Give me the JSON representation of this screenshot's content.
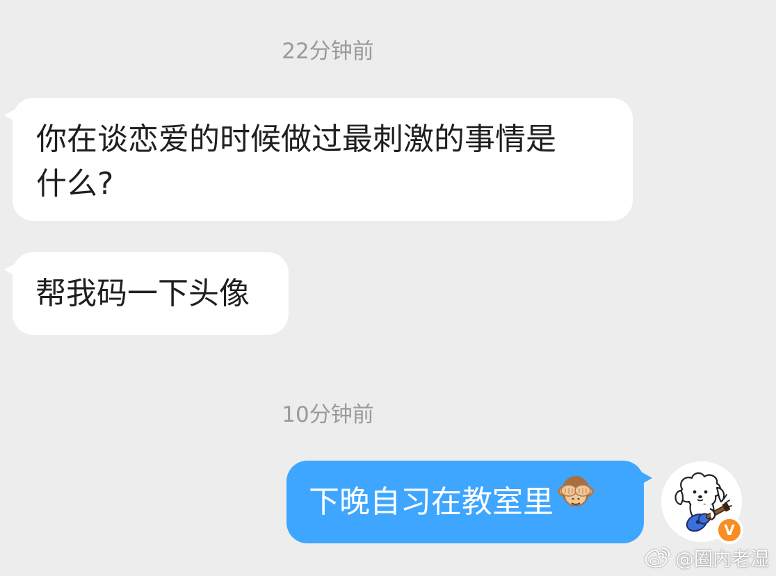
{
  "chat": {
    "timestamp_1": "22分钟前",
    "timestamp_2": "10分钟前",
    "messages": [
      {
        "direction": "incoming",
        "text_line1": "你在谈恋爱的时候做过最刺激的事情是",
        "text_line2": "什么?"
      },
      {
        "direction": "incoming",
        "text": "帮我码一下头像"
      },
      {
        "direction": "outgoing",
        "text": "下晚自习在教室里",
        "emoji": "see-no-evil-monkey-icon"
      }
    ],
    "sender": {
      "avatar_icon": "dog-playing-guitar-icon",
      "verified_badge": "V",
      "badge_color": "#f98d21"
    }
  },
  "watermark": {
    "icon": "weibo-icon",
    "text": "@圈内老湿"
  },
  "colors": {
    "background": "#ededed",
    "incoming_bubble": "#ffffff",
    "outgoing_bubble": "#3ea6ff",
    "timestamp_text": "#9a9a9a"
  }
}
